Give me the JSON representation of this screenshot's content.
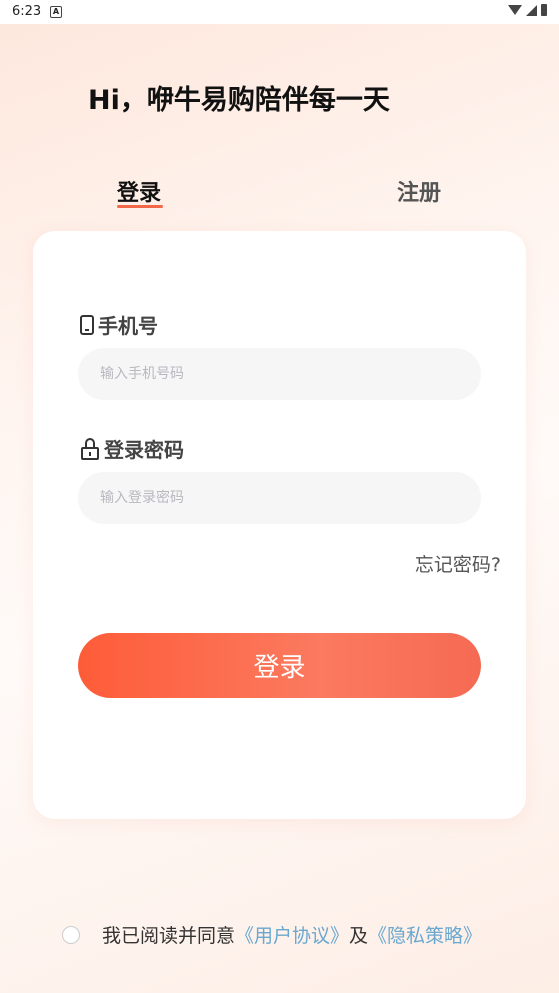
{
  "status_bar": {
    "time": "6:23",
    "notification_icon": "A"
  },
  "header": {
    "greeting": "Hi，咿牛易购陪伴每一天"
  },
  "tabs": {
    "login": "登录",
    "register": "注册",
    "active": "login"
  },
  "form": {
    "phone_label": "手机号",
    "phone_placeholder": "输入手机号码",
    "phone_value": "",
    "password_label": "登录密码",
    "password_placeholder": "输入登录密码",
    "password_value": "",
    "forgot_password": "忘记密码?",
    "submit_label": "登录"
  },
  "agreement": {
    "checked": false,
    "prefix": "我已阅读并同意",
    "user_agreement": "《用户协议》",
    "conjunction": "及",
    "privacy_policy": "《隐私策略》"
  },
  "colors": {
    "accent": "#f2694a",
    "button_start": "#fe5c38",
    "link": "#6aa8cf"
  },
  "icons": {
    "phone_label": "smartphone-icon",
    "password_label": "lock-icon"
  }
}
